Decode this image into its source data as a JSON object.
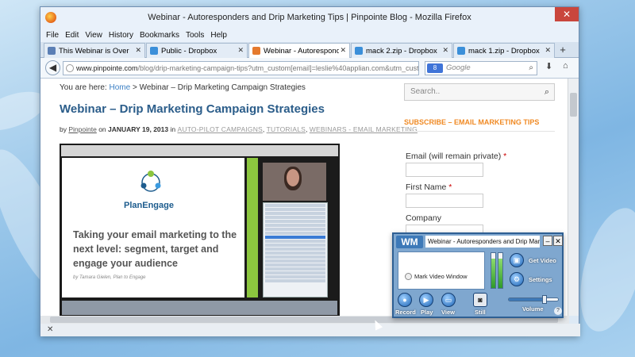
{
  "window": {
    "title": "Webinar - Autoresponders and Drip Marketing Tips | Pinpointe Blog - Mozilla Firefox",
    "close_glyph": "✕"
  },
  "menu": [
    "File",
    "Edit",
    "View",
    "History",
    "Bookmarks",
    "Tools",
    "Help"
  ],
  "tabs": [
    {
      "label": "This Webinar is Over",
      "color": "#5b7fb5",
      "active": false
    },
    {
      "label": "Public - Dropbox",
      "color": "#3b8fd9",
      "active": false
    },
    {
      "label": "Webinar - Autoresponders ...",
      "color": "#e57a2e",
      "active": true
    },
    {
      "label": "mack 2.zip - Dropbox",
      "color": "#3b8fd9",
      "active": false
    },
    {
      "label": "mack 1.zip - Dropbox",
      "color": "#3b8fd9",
      "active": false
    }
  ],
  "nav": {
    "url_domain": "www.pinpointe.com",
    "url_rest": "/blog/drip-marketing-campaign-tips?utm_custom[email]=leslie%40applian.com&utm_custon",
    "search_placeholder": "Google",
    "search_engine": "8"
  },
  "page": {
    "breadcrumb_prefix": "You are here:",
    "breadcrumb_home": "Home",
    "breadcrumb_sep": ">",
    "breadcrumb_current": "Webinar – Drip Marketing Campaign Strategies",
    "title": "Webinar – Drip Marketing Campaign Strategies",
    "byline_by": "by",
    "author": "Pinpointe",
    "byline_on": "on",
    "date": "JANUARY 19, 2013",
    "byline_in": "in",
    "categories": [
      "AUTO-PILOT CAMPAIGNS",
      "TUTORIALS",
      "WEBINARS - EMAIL MARKETING"
    ],
    "slide_logo": "PlanEngage",
    "slide_heading": "Taking your email marketing to the next level: segment, target and engage your audience",
    "slide_byline": "by Tamara Gielen, Plan to Engage"
  },
  "sidebar": {
    "search_placeholder": "Search..",
    "subscribe_heading": "SUBSCRIBE – EMAIL MARKETING TIPS",
    "fields": [
      {
        "label": "Email (will remain private)",
        "required": true
      },
      {
        "label": "First Name",
        "required": true
      },
      {
        "label": "Company",
        "required": false
      }
    ]
  },
  "wm": {
    "logo": "WM",
    "title": "Webinar - Autoresponders and Drip Marketin",
    "mark_video_window": "Mark Video Window",
    "get_video": "Get Video",
    "settings": "Settings",
    "record": "Record",
    "play": "Play",
    "view": "View",
    "still": "Still",
    "volume": "Volume",
    "volume_level": 0.72,
    "meter_left": 0.85,
    "meter_right": 0.85,
    "help": "?"
  },
  "status": {
    "close_glyph": "✕"
  }
}
